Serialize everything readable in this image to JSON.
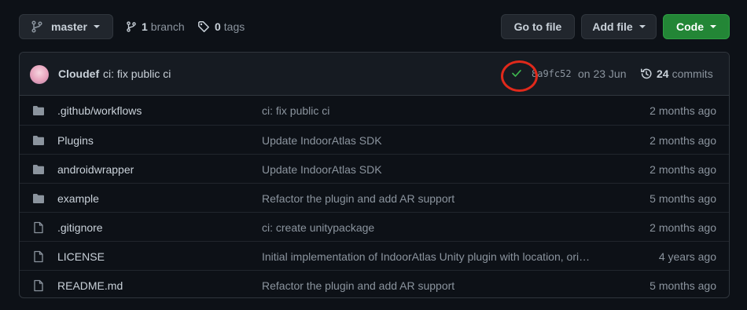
{
  "toolbar": {
    "branch_name": "master",
    "branch_count": "1",
    "branch_label": "branch",
    "tag_count": "0",
    "tag_label": "tags",
    "go_to_file": "Go to file",
    "add_file": "Add file",
    "code": "Code"
  },
  "latest_commit": {
    "author": "Cloudef",
    "message": "ci: fix public ci",
    "status": "success",
    "sha": "8a9fc52",
    "date": "on 23 Jun",
    "commit_count": "24",
    "commit_label": "commits"
  },
  "files": [
    {
      "type": "directory",
      "name": ".github/workflows",
      "message": "ci: fix public ci",
      "age": "2 months ago"
    },
    {
      "type": "directory",
      "name": "Plugins",
      "message": "Update IndoorAtlas SDK",
      "age": "2 months ago"
    },
    {
      "type": "directory",
      "name": "androidwrapper",
      "message": "Update IndoorAtlas SDK",
      "age": "2 months ago"
    },
    {
      "type": "directory",
      "name": "example",
      "message": "Refactor the plugin and add AR support",
      "age": "5 months ago"
    },
    {
      "type": "file",
      "name": ".gitignore",
      "message": "ci: create unitypackage",
      "age": "2 months ago"
    },
    {
      "type": "file",
      "name": "LICENSE",
      "message": "Initial implementation of IndoorAtlas Unity plugin with location, ori…",
      "age": "4 years ago"
    },
    {
      "type": "file",
      "name": "README.md",
      "message": "Refactor the plugin and add AR support",
      "age": "5 months ago"
    }
  ],
  "colors": {
    "background": "#0d1117",
    "header_bg": "#161b22",
    "border": "#30363d",
    "primary_button": "#238636",
    "success_check": "#3fb950",
    "annotation_ring": "#e0291b",
    "folder_icon": "#8b949e"
  }
}
